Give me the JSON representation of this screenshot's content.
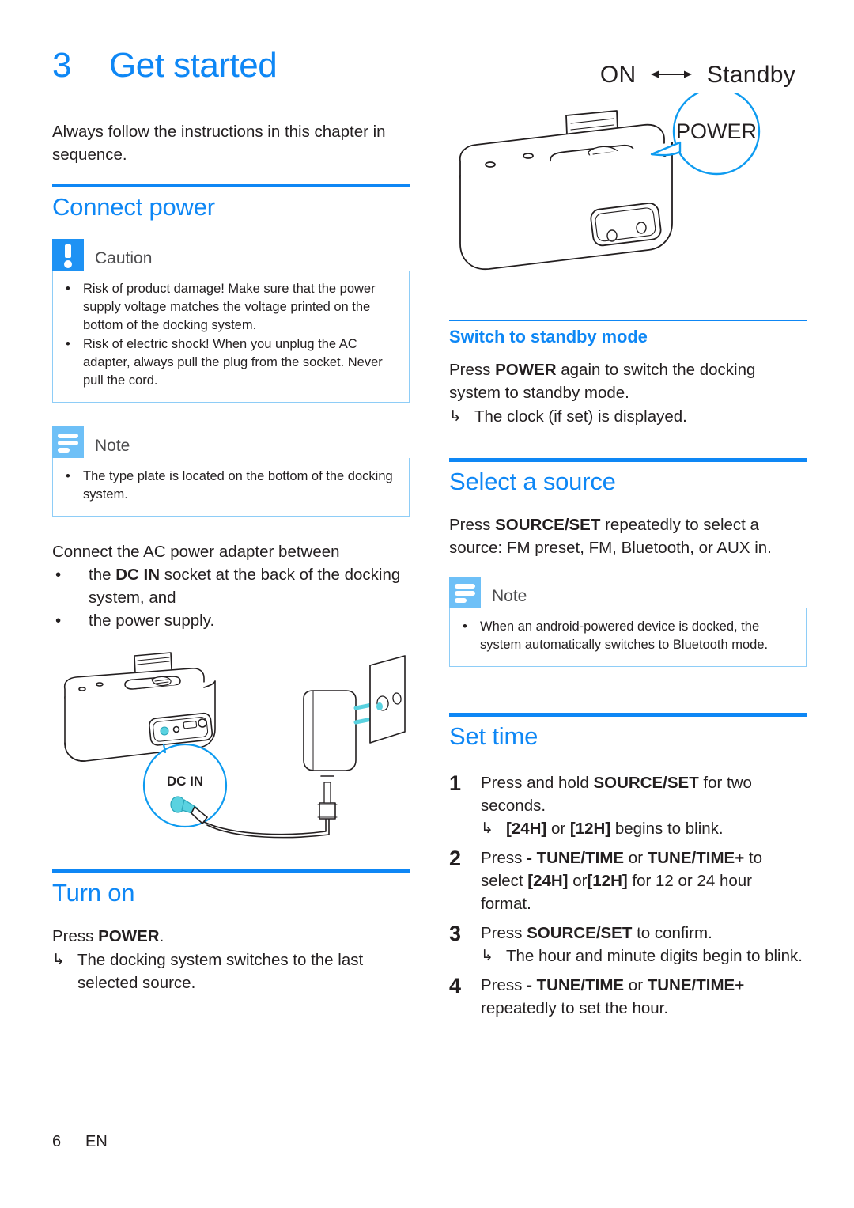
{
  "chapter": {
    "number": "3",
    "title": "Get started",
    "intro": "Always follow the instructions in this chapter in sequence."
  },
  "connect_power": {
    "heading": "Connect power",
    "caution": {
      "title": "Caution",
      "icon": "caution-exclamation-icon",
      "items": [
        "Risk of product damage! Make sure that the power supply voltage matches the voltage printed on the bottom of the docking system.",
        "Risk of electric shock! When you unplug the AC adapter, always pull the plug from the socket. Never pull the cord."
      ]
    },
    "note": {
      "title": "Note",
      "icon": "note-lines-icon",
      "items": [
        "The type plate is located on the bottom of the docking system."
      ]
    },
    "lead": "Connect the AC power adapter between",
    "bullets": [
      {
        "pre": "the ",
        "bold": "DC IN",
        "post": " socket at the back of the docking system, and"
      },
      {
        "pre": "the power supply.",
        "bold": "",
        "post": ""
      }
    ],
    "figure_label": "DC IN"
  },
  "turn_on": {
    "heading": "Turn on",
    "press_pre": "Press ",
    "press_bold": "POWER",
    "press_post": ".",
    "result": "The docking system switches to the last selected source."
  },
  "standby_diagram": {
    "on_label": "ON",
    "arrow": "⟷",
    "standby_label": "Standby",
    "callout_label": "POWER"
  },
  "switch_standby": {
    "heading": "Switch to standby mode",
    "line_pre": "Press ",
    "line_bold": "POWER",
    "line_post": " again to switch the docking system to standby mode.",
    "result": "The clock (if set) is displayed."
  },
  "select_source": {
    "heading": "Select a source",
    "line_pre": "Press ",
    "line_bold": "SOURCE/SET",
    "line_post": " repeatedly to select a source: FM preset, FM, Bluetooth, or AUX in.",
    "note": {
      "title": "Note",
      "icon": "note-lines-icon",
      "items": [
        "When an android-powered device is docked, the system automatically switches to Bluetooth mode."
      ]
    }
  },
  "set_time": {
    "heading": "Set time",
    "steps": [
      {
        "num": "1",
        "pre": "Press and hold ",
        "bold": "SOURCE/SET",
        "post": " for two seconds.",
        "result_pre": "",
        "result_bold1": "[24H]",
        "result_mid": " or ",
        "result_bold2": "[12H]",
        "result_post": " begins to blink."
      },
      {
        "num": "2",
        "pre": "Press ",
        "bold": "- TUNE/TIME",
        "mid": " or ",
        "bold2": "TUNE/TIME+",
        "post": " to select ",
        "bold3": "[24H]",
        "post2": " or",
        "bold4": "[12H]",
        "post3": " for 12 or 24 hour format."
      },
      {
        "num": "3",
        "pre": "Press ",
        "bold": "SOURCE/SET",
        "post": " to confirm.",
        "result": "The hour and minute digits begin to blink."
      },
      {
        "num": "4",
        "pre": "Press ",
        "bold": "- TUNE/TIME",
        "mid": " or ",
        "bold2": "TUNE/TIME+",
        "post": " repeatedly to set the hour."
      }
    ]
  },
  "footer": {
    "page_number": "6",
    "language": "EN"
  },
  "colors": {
    "accent_blue": "#0e87f5",
    "caution_icon_blue": "#1e92f4",
    "note_icon_blue": "#6ec0f7",
    "callout_border": "#8ecdf7",
    "figure_cyan": "#5ad2e0",
    "text": "#231f20"
  }
}
